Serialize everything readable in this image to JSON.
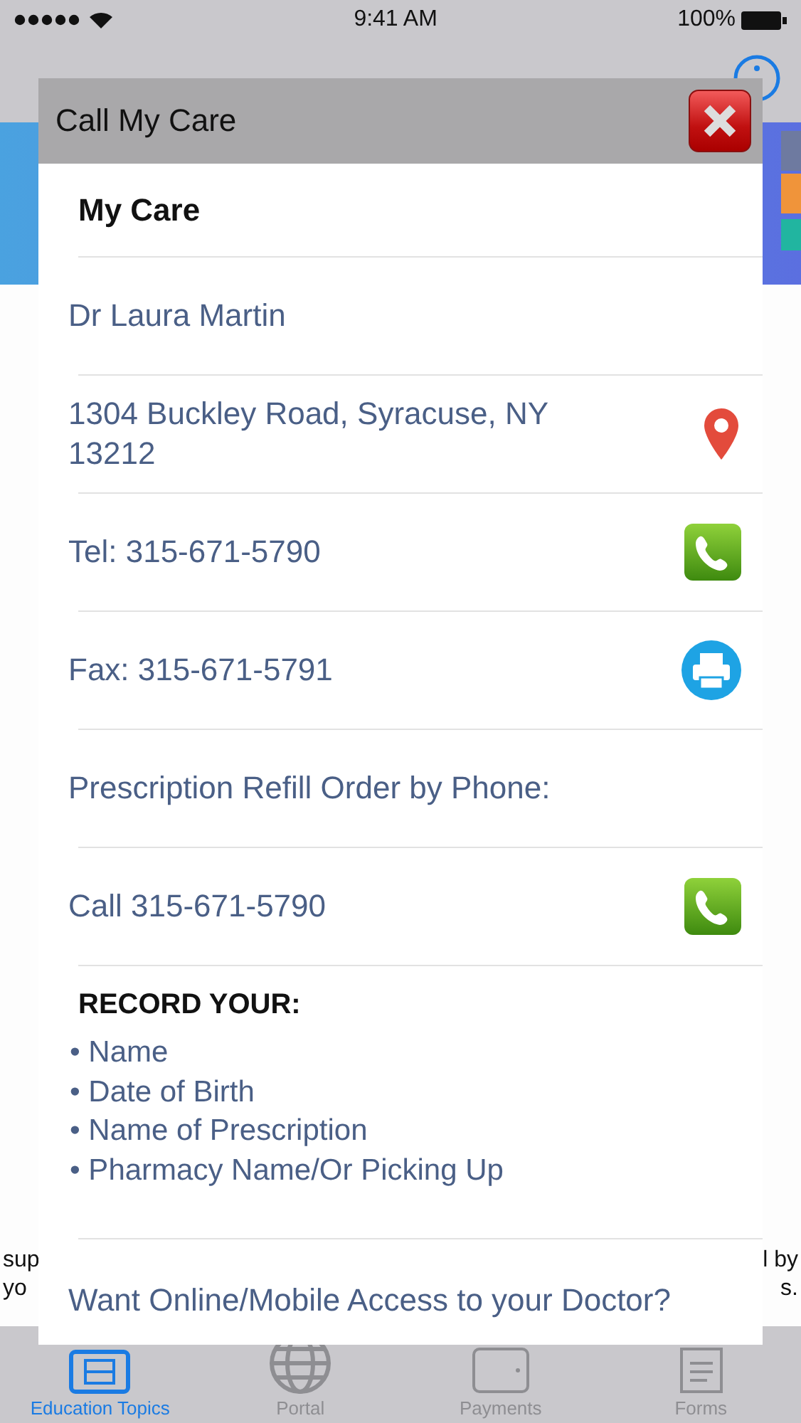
{
  "status_bar": {
    "time": "9:41 AM",
    "battery": "100%"
  },
  "background_fragments": {
    "left": [
      "sup",
      "yo"
    ],
    "right": [
      "l by",
      "s."
    ]
  },
  "dialog": {
    "title": "Call My Care",
    "rows": [
      {
        "kind": "heading",
        "text": "My Care"
      },
      {
        "kind": "line",
        "text": "Dr Laura Martin"
      },
      {
        "kind": "address",
        "text": "1304 Buckley Road, Syracuse, NY 13212"
      },
      {
        "kind": "phone",
        "text": "Tel: 315-671-5790"
      },
      {
        "kind": "fax",
        "text": "Fax: 315-671-5791"
      },
      {
        "kind": "line",
        "text": "Prescription Refill Order by Phone:"
      },
      {
        "kind": "phone",
        "text": "Call 315-671-5790"
      }
    ],
    "record": {
      "heading": "RECORD YOUR:",
      "items": [
        "• Name",
        "• Date of Birth",
        "• Name of Prescription",
        "• Pharmacy Name/Or Picking Up"
      ]
    },
    "footer": "Want Online/Mobile Access to your Doctor?"
  },
  "tabs": [
    {
      "label": "Education Topics",
      "selected": true
    },
    {
      "label": "Portal",
      "selected": false
    },
    {
      "label": "Payments",
      "selected": false
    },
    {
      "label": "Forms",
      "selected": false
    }
  ]
}
